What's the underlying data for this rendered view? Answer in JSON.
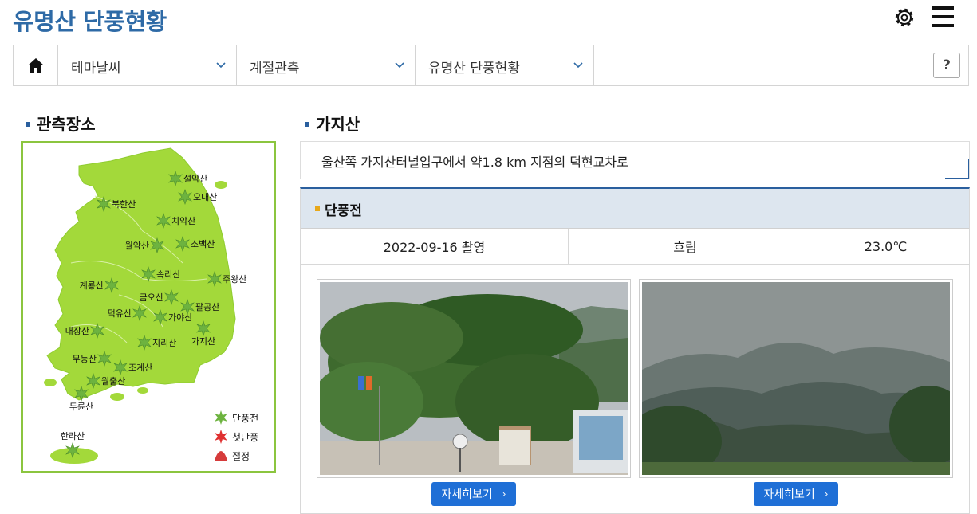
{
  "header": {
    "title": "유명산 단풍현황"
  },
  "nav": {
    "items": [
      {
        "label": "테마날씨"
      },
      {
        "label": "계절관측"
      },
      {
        "label": "유명산 단풍현황"
      }
    ],
    "help_label": "?"
  },
  "observation": {
    "section_title": "관측장소",
    "mountains": [
      "설악산",
      "오대산",
      "북한산",
      "치악산",
      "월악산",
      "소백산",
      "계룡산",
      "속리산",
      "주왕산",
      "금오산",
      "팔공산",
      "덕유산",
      "가야산",
      "내장산",
      "지리산",
      "가지산",
      "무등산",
      "조계산",
      "월출산",
      "두륜산",
      "한라산"
    ],
    "legend": [
      {
        "label": "단풍전",
        "color": "#7cc242"
      },
      {
        "label": "첫단풍",
        "color": "#e03030"
      },
      {
        "label": "절정",
        "color": "#d63b3b"
      }
    ]
  },
  "detail": {
    "mountain_name": "가지산",
    "location_text": "울산쪽 가지산터널입구에서 약1.8 km 지점의 덕현교차로",
    "status_title": "단풍전",
    "date": "2022-09-16 촬영",
    "weather": "흐림",
    "temperature": "23.0℃",
    "button_label": "자세히보기"
  },
  "colors": {
    "brand": "#2e6aa6",
    "button": "#1f6fd6",
    "map_land": "#a3d93a",
    "map_border": "#8bc53f"
  }
}
